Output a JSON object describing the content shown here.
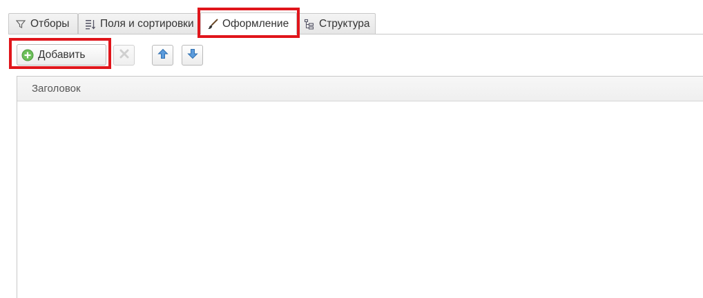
{
  "tabs": [
    {
      "label": "Отборы",
      "icon": "filter-icon"
    },
    {
      "label": "Поля и сортировки",
      "icon": "fields-sort-icon"
    },
    {
      "label": "Оформление",
      "icon": "brush-icon",
      "active": true
    },
    {
      "label": "Структура",
      "icon": "structure-icon"
    }
  ],
  "toolbar": {
    "add_label": "Добавить",
    "add_icon": "plus-circle-icon",
    "delete_icon": "delete-x-icon",
    "up_icon": "arrow-up-icon",
    "down_icon": "arrow-down-icon"
  },
  "table": {
    "columns": [
      "Заголовок"
    ],
    "rows": []
  },
  "colors": {
    "highlight": "#e0151b",
    "add_icon_green": "#5cb85c",
    "arrow_blue": "#4a90d9"
  }
}
